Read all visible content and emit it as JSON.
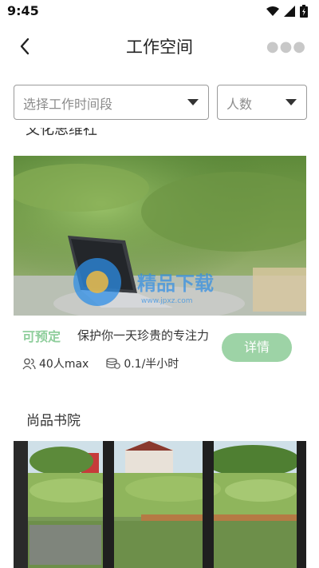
{
  "status": {
    "time": "9:45"
  },
  "header": {
    "title": "工作空间"
  },
  "filters": {
    "time_placeholder": "选择工作时间段",
    "people_placeholder": "人数"
  },
  "cards": [
    {
      "title_partial": "文化思维社",
      "tag": "可预定",
      "desc": "保护你一天珍贵的专注力",
      "button": "详情",
      "capacity": "40人max",
      "price": "0.1/半小时"
    },
    {
      "title": "尚品书院"
    }
  ],
  "watermark": {
    "text": "精品下载",
    "sub": "www.jpxz.com"
  },
  "colors": {
    "accent": "#9dd3a6",
    "tag": "#8fce9c"
  }
}
